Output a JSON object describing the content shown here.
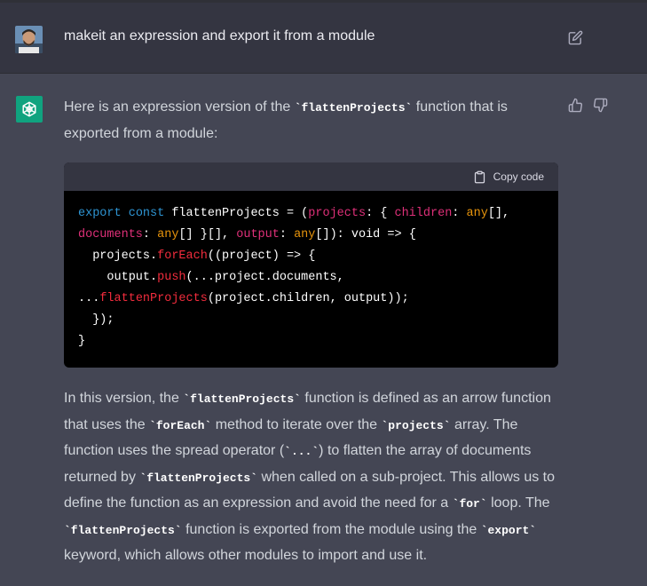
{
  "user_message": {
    "text": "makeit an expression and export it from a module"
  },
  "assistant": {
    "intro_parts": [
      "Here is an expression version of the ",
      "`flattenProjects`",
      " function that is exported from a module:"
    ],
    "code_block": {
      "copy_label": "Copy code",
      "lines": [
        [
          {
            "t": "export",
            "c": "kw"
          },
          {
            "t": " ",
            "c": "plain"
          },
          {
            "t": "const",
            "c": "kw"
          },
          {
            "t": " flattenProjects = (",
            "c": "plain"
          },
          {
            "t": "projects",
            "c": "param"
          },
          {
            "t": ": { ",
            "c": "plain"
          },
          {
            "t": "children",
            "c": "param"
          },
          {
            "t": ": ",
            "c": "plain"
          },
          {
            "t": "any",
            "c": "type"
          },
          {
            "t": "[],",
            "c": "plain"
          }
        ],
        [
          {
            "t": "documents",
            "c": "param"
          },
          {
            "t": ": ",
            "c": "plain"
          },
          {
            "t": "any",
            "c": "type"
          },
          {
            "t": "[] }[], ",
            "c": "plain"
          },
          {
            "t": "output",
            "c": "param"
          },
          {
            "t": ": ",
            "c": "plain"
          },
          {
            "t": "any",
            "c": "type"
          },
          {
            "t": "[]): void => {",
            "c": "plain"
          }
        ],
        [
          {
            "t": "  projects.",
            "c": "plain"
          },
          {
            "t": "forEach",
            "c": "fn"
          },
          {
            "t": "((project) => {",
            "c": "plain"
          }
        ],
        [
          {
            "t": "    output.",
            "c": "plain"
          },
          {
            "t": "push",
            "c": "fn"
          },
          {
            "t": "(...project.documents,",
            "c": "plain"
          }
        ],
        [
          {
            "t": "...",
            "c": "plain"
          },
          {
            "t": "flattenProjects",
            "c": "fn"
          },
          {
            "t": "(project.children, output));",
            "c": "plain"
          }
        ],
        [
          {
            "t": "  });",
            "c": "plain"
          }
        ],
        [
          {
            "t": "}",
            "c": "plain"
          }
        ]
      ]
    },
    "explanation_parts": [
      {
        "t": "In this version, the ",
        "code": false
      },
      {
        "t": "`flattenProjects`",
        "code": true
      },
      {
        "t": " function is defined as an arrow function that uses the ",
        "code": false
      },
      {
        "t": "`forEach`",
        "code": true
      },
      {
        "t": " method to iterate over the ",
        "code": false
      },
      {
        "t": "`projects`",
        "code": true
      },
      {
        "t": " array. The function uses the spread operator (",
        "code": false
      },
      {
        "t": "`...`",
        "code": true
      },
      {
        "t": ") to flatten the array of documents returned by ",
        "code": false
      },
      {
        "t": "`flattenProjects`",
        "code": true
      },
      {
        "t": " when called on a sub-project. This allows us to define the function as an expression and avoid the need for a ",
        "code": false
      },
      {
        "t": "`for`",
        "code": true
      },
      {
        "t": " loop. The ",
        "code": false
      },
      {
        "t": "`flattenProjects`",
        "code": true
      },
      {
        "t": " function is exported from the module using the ",
        "code": false
      },
      {
        "t": "`export`",
        "code": true
      },
      {
        "t": " keyword, which allows other modules to import and use it.",
        "code": false
      }
    ]
  },
  "icons": {
    "user_avatar": "avatar",
    "edit": "edit-icon",
    "assistant_logo": "openai-logo-icon",
    "thumbs_up": "thumbs-up-icon",
    "thumbs_down": "thumbs-down-icon",
    "copy": "clipboard-icon"
  },
  "colors": {
    "page_bg": "#444654",
    "user_row_bg": "#343541",
    "code_bg": "#000000",
    "keyword": "#2e95d3",
    "param": "#df3079",
    "type": "#e9950c",
    "function": "#f22c3d",
    "logo_bg": "#10a37f"
  }
}
